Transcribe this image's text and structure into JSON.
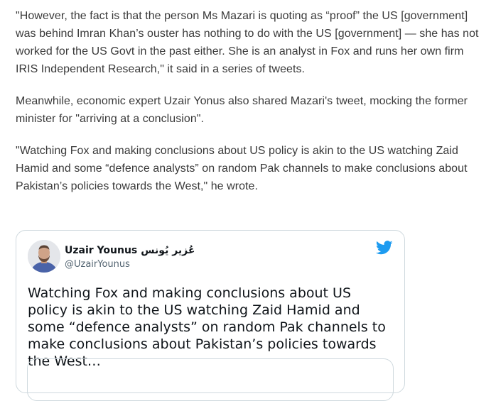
{
  "article": {
    "paragraphs": [
      "\"However, the fact is that the person Ms Mazari is quoting as “proof” the US [government] was behind Imran Khan’s ouster has nothing to do with the US [government] — she has not worked for the US Govt in the past either. She is an analyst in Fox and runs her own firm IRIS Independent Research,\" it said in a series of tweets.",
      "Meanwhile, economic expert Uzair Yonus also shared Mazari's tweet, mocking the former minister for \"arriving at a conclusion\".",
      "\"Watching Fox and making conclusions about US policy is akin to the US watching Zaid Hamid and some “defence analysts” on random Pak channels to make conclusions about Pakistan’s policies towards the West,\" he wrote."
    ]
  },
  "tweet": {
    "author_name": "Uzair Younus",
    "author_name_arabic": "عُزیر یُونس",
    "author_handle": "@UzairYounus",
    "text": "Watching Fox and making conclusions about US policy is akin to the US watching Zaid Hamid and some “defence analysts” on random Pak channels to make conclusions about Pakistan’s policies towards the West…",
    "avatar_icon": "user-avatar",
    "platform_icon": "twitter-bird-icon",
    "brand_color": "#1d9bf0"
  }
}
